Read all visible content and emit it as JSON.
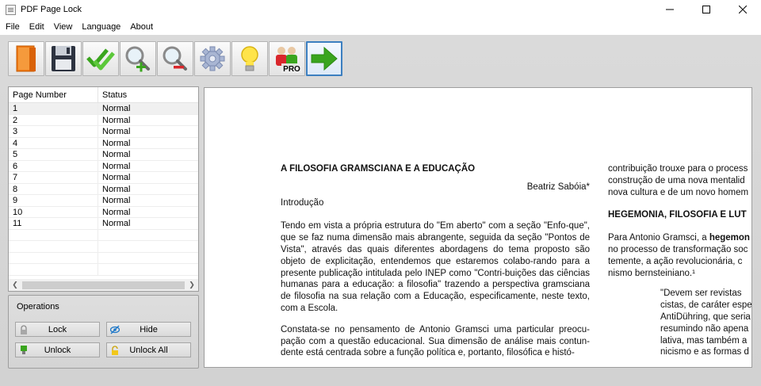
{
  "window": {
    "title": "PDF Page Lock",
    "controls": [
      "minimize",
      "maximize",
      "close"
    ]
  },
  "menu": [
    "File",
    "Edit",
    "View",
    "Language",
    "About"
  ],
  "toolbar": {
    "buttons": [
      {
        "name": "open-button",
        "icon": "open-book-icon"
      },
      {
        "name": "save-button",
        "icon": "floppy-disk-icon"
      },
      {
        "name": "select-all-button",
        "icon": "double-check-icon"
      },
      {
        "name": "zoom-in-button",
        "icon": "zoom-in-icon"
      },
      {
        "name": "zoom-out-button",
        "icon": "zoom-out-icon"
      },
      {
        "name": "settings-button",
        "icon": "gear-icon"
      },
      {
        "name": "tips-button",
        "icon": "lightbulb-icon"
      },
      {
        "name": "pro-button",
        "icon": "pro-users-icon",
        "badge": "PRO"
      },
      {
        "name": "next-button",
        "icon": "green-arrow-icon"
      }
    ]
  },
  "table": {
    "headers": [
      "Page Number",
      "Status"
    ],
    "rows": [
      {
        "page": "1",
        "status": "Normal"
      },
      {
        "page": "2",
        "status": "Normal"
      },
      {
        "page": "3",
        "status": "Normal"
      },
      {
        "page": "4",
        "status": "Normal"
      },
      {
        "page": "5",
        "status": "Normal"
      },
      {
        "page": "6",
        "status": "Normal"
      },
      {
        "page": "7",
        "status": "Normal"
      },
      {
        "page": "8",
        "status": "Normal"
      },
      {
        "page": "9",
        "status": "Normal"
      },
      {
        "page": "10",
        "status": "Normal"
      },
      {
        "page": "11",
        "status": "Normal"
      }
    ]
  },
  "operations": {
    "title": "Operations",
    "lock": "Lock",
    "hide": "Hide",
    "unlock": "Unlock",
    "unlock_all": "Unlock All"
  },
  "document": {
    "title": "A FILOSOFIA GRAMSCIANA E A EDUCAÇÃO",
    "author": "Beatriz Sabóia*",
    "section": "Introdução",
    "para1": "Tendo em vista a própria estrutura do \"Em aberto\" com a seção \"Enfo-que\", que se faz numa dimensão mais abrangente, seguida da seção \"Pontos de Vista\", através das quais diferentes abordagens do tema proposto são objeto de explicitação, entendemos que estaremos colabo-rando para a presente publicação intitulada pelo INEP como \"Contri-buições das ciências humanas para a educação: a filosofia\" trazendo a perspectiva gramsciana de filosofia na sua relação com a Educação, especificamente, neste texto, com a Escola.",
    "para2": "Constata-se no pensamento de Antonio Gramsci uma particular preocu-pação com a questão educacional. Sua dimensão de análise mais contun-dente está centrada sobre a função política e, portanto, filosófica e histó-",
    "right_lines": [
      "contribuição trouxe para o process",
      "construção de uma nova mentalid",
      "nova cultura e de um novo homem"
    ],
    "right_heading": "HEGEMONIA, FILOSOFIA E LUT",
    "right_para_lead": "Para Antonio Gramsci, a ",
    "right_para_bold": "hegemon",
    "right_para_lines": [
      "no processo de transformação soc",
      "temente, a ação revolucionária, c",
      "nismo bernsteiniano.¹"
    ],
    "quote_lines": [
      "\"Devem ser revistas",
      "cistas, de caráter espe",
      "AntiDühring, que seria",
      "resumindo não apena",
      "lativa, mas também a",
      "nicismo e as formas d"
    ]
  }
}
